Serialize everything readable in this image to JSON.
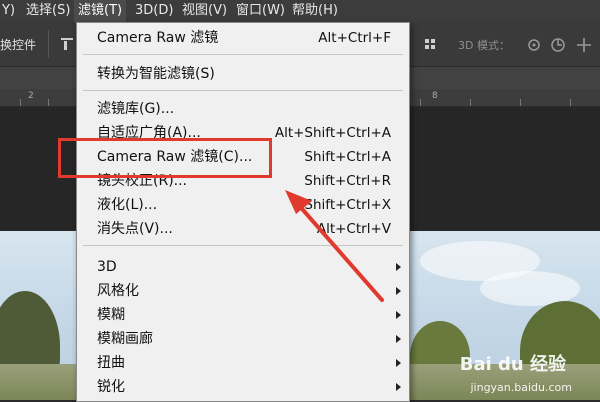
{
  "menubar": {
    "items": [
      "Y)",
      "选择(S)",
      "滤镜(T)",
      "3D(D)",
      "视图(V)",
      "窗口(W)",
      "帮助(H)"
    ]
  },
  "options_bar": {
    "left_label": "换控件",
    "mode_label": "3D 模式："
  },
  "ruler": {
    "labels": [
      "2",
      "8"
    ]
  },
  "filter_menu": {
    "top_item": {
      "label": "Camera Raw 滤镜",
      "shortcut": "Alt+Ctrl+F"
    },
    "convert_item": {
      "label": "转换为智能滤镜(S)"
    },
    "items": [
      {
        "label": "滤镜库(G)...",
        "shortcut": ""
      },
      {
        "label": "自适应广角(A)...",
        "shortcut": "Alt+Shift+Ctrl+A"
      },
      {
        "label": "Camera Raw 滤镜(C)...",
        "shortcut": "Shift+Ctrl+A"
      },
      {
        "label": "镜头校正(R)...",
        "shortcut": "Shift+Ctrl+R"
      },
      {
        "label": "液化(L)...",
        "shortcut": "Shift+Ctrl+X"
      },
      {
        "label": "消失点(V)...",
        "shortcut": "Alt+Ctrl+V"
      }
    ],
    "submenus": [
      "3D",
      "风格化",
      "模糊",
      "模糊画廊",
      "扭曲",
      "锐化"
    ]
  },
  "annotation": {
    "color": "#e0392e"
  },
  "watermark": {
    "brand": "Bai du 经验",
    "url": "jingyan.baidu.com"
  }
}
